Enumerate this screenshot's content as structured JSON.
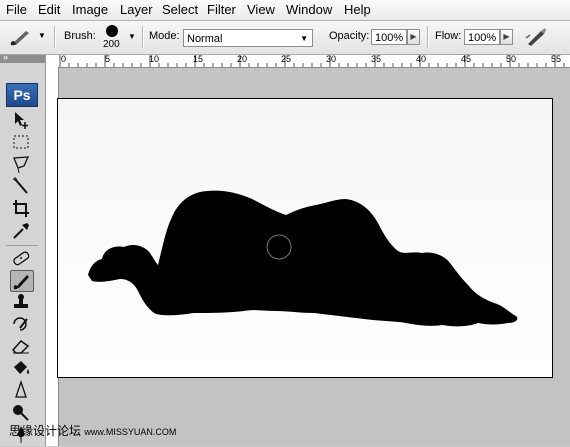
{
  "menu": [
    "File",
    "Edit",
    "Image",
    "Layer",
    "Select",
    "Filter",
    "View",
    "Window",
    "Help"
  ],
  "options": {
    "brush_label": "Brush:",
    "brush_size": "200",
    "mode_label": "Mode:",
    "mode_value": "Normal",
    "opacity_label": "Opacity:",
    "opacity_value": "100%",
    "flow_label": "Flow:",
    "flow_value": "100%"
  },
  "toolbox": {
    "logo": "Ps",
    "tools": [
      "move-icon",
      "marquee-icon",
      "lasso-icon",
      "magic-wand-icon",
      "crop-icon",
      "eyedropper-icon",
      "healing-brush-icon",
      "brush-icon",
      "clone-stamp-icon",
      "history-brush-icon",
      "eraser-icon",
      "paint-bucket-icon",
      "blur-icon",
      "dodge-icon",
      "pen-icon"
    ],
    "active_tool": "brush-icon"
  },
  "ruler": {
    "labels": [
      "0",
      "5",
      "10",
      "15",
      "20",
      "25",
      "30",
      "35",
      "40",
      "45",
      "50",
      "55"
    ]
  },
  "watermark": {
    "text_cn": "思缘设计论坛",
    "text_en": "www.MISSYUAN.COM"
  },
  "colors": {
    "silhouette": "#000000",
    "canvas_bg": "#ffffff",
    "workspace_bg": "#c3c3c3"
  }
}
